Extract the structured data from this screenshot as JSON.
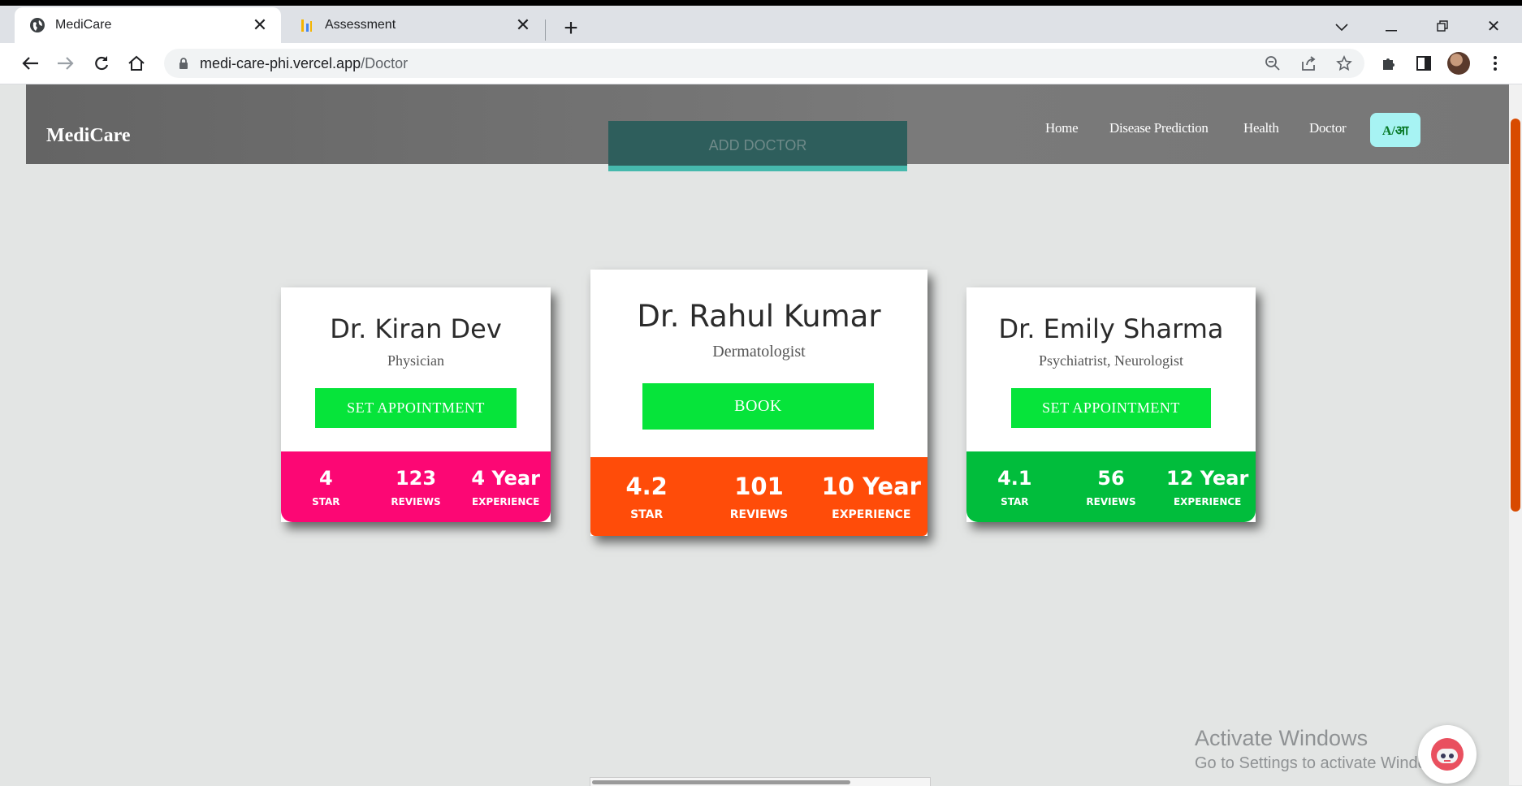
{
  "browser": {
    "tabs": [
      {
        "title": "MediCare",
        "active": true
      },
      {
        "title": "Assessment",
        "active": false
      }
    ],
    "new_tab_symbol": "+",
    "url_host": "medi-care-phi.vercel.app",
    "url_path": "/Doctor"
  },
  "nav": {
    "brand": "MediCare",
    "links": [
      "Home",
      "Disease Prediction",
      "Health",
      "Doctor"
    ],
    "lang_toggle": "A/आ",
    "add_doctor": "ADD DOCTOR"
  },
  "doctors": [
    {
      "name": "Dr. Kiran Dev",
      "specialty": "Physician",
      "action": "SET APPOINTMENT",
      "star": "4",
      "reviews": "123",
      "experience": "4 Year",
      "color": "#fc0774"
    },
    {
      "name": "Dr. Rahul Kumar",
      "specialty": "Dermatologist",
      "action": "BOOK",
      "star": "4.2",
      "reviews": "101",
      "experience": "10 Year",
      "color": "#ff4c09"
    },
    {
      "name": "Dr. Emily Sharma",
      "specialty": "Psychiatrist, Neurologist",
      "action": "SET APPOINTMENT",
      "star": "4.1",
      "reviews": "56",
      "experience": "12 Year",
      "color": "#01bd3c"
    }
  ],
  "stat_labels": {
    "star": "STAR",
    "reviews": "REVIEWS",
    "experience": "EXPERIENCE"
  },
  "watermark": {
    "line1": "Activate Windows",
    "line2": "Go to Settings to activate Windows."
  }
}
